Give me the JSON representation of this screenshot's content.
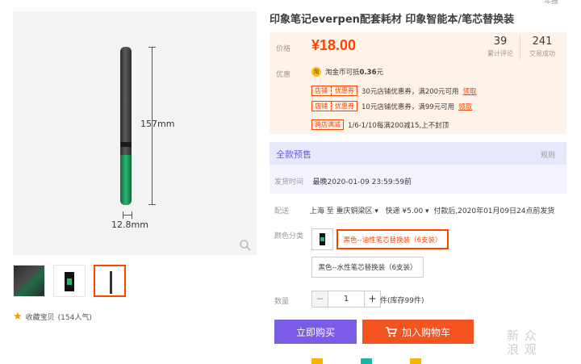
{
  "top_right": "年报",
  "product": {
    "title": "印象笔记everpen配套耗材 印象智能本/笔芯替换装",
    "dims": {
      "length": "157mm",
      "width": "12.8mm"
    }
  },
  "favorite": {
    "label": "收藏宝贝",
    "count": "(154人气)"
  },
  "price": {
    "label": "价格",
    "value": "¥18.00",
    "reviews": {
      "num": "39",
      "label": "累计评论"
    },
    "sales": {
      "num": "241",
      "label": "交易成功"
    }
  },
  "promo": {
    "label": "优惠",
    "coin": {
      "icon": "淘",
      "text": "淘金币可抵",
      "amount": "0.36",
      "unit": "元"
    },
    "coupons": [
      {
        "tag_a": "店铺",
        "tag_b": "优惠券",
        "text": "30元店铺优惠券，满200元可用",
        "get": "领取"
      },
      {
        "tag_a": "店铺",
        "tag_b": "优惠券",
        "text": "10元店铺优惠券，满99元可用",
        "get": "领取"
      }
    ],
    "cross_store": {
      "tag": "跨店满减",
      "text": "1/6-1/10每满200减15,上不封顶"
    }
  },
  "presale": {
    "title": "全款预售",
    "rule": "规则"
  },
  "ship_deadline": {
    "label": "发货时间",
    "value": "最晚2020-01-09 23:59:59前"
  },
  "delivery": {
    "label": "配送",
    "from": "上海",
    "to_word": "至",
    "to": "重庆铜梁区",
    "method": "快递 ¥5.00",
    "note": "付款后,2020年01月09日24点前发货"
  },
  "sku": {
    "label": "颜色分类",
    "options": [
      "黑色--油性笔芯替换装（6支装）",
      "黑色--水性笔芯替换装（6支装）"
    ]
  },
  "quantity": {
    "label": "数量",
    "value": "1",
    "minus": "−",
    "plus": "+",
    "stock": "件(库存99件)"
  },
  "buttons": {
    "buy": "立即购买",
    "cart": "加入购物车"
  },
  "watermark": "新 众\n浪 观",
  "colors": {
    "accent": "#ff4400",
    "buy": "#7b5ce6",
    "cart": "#f5531f",
    "presale": "#6a5bdc"
  }
}
